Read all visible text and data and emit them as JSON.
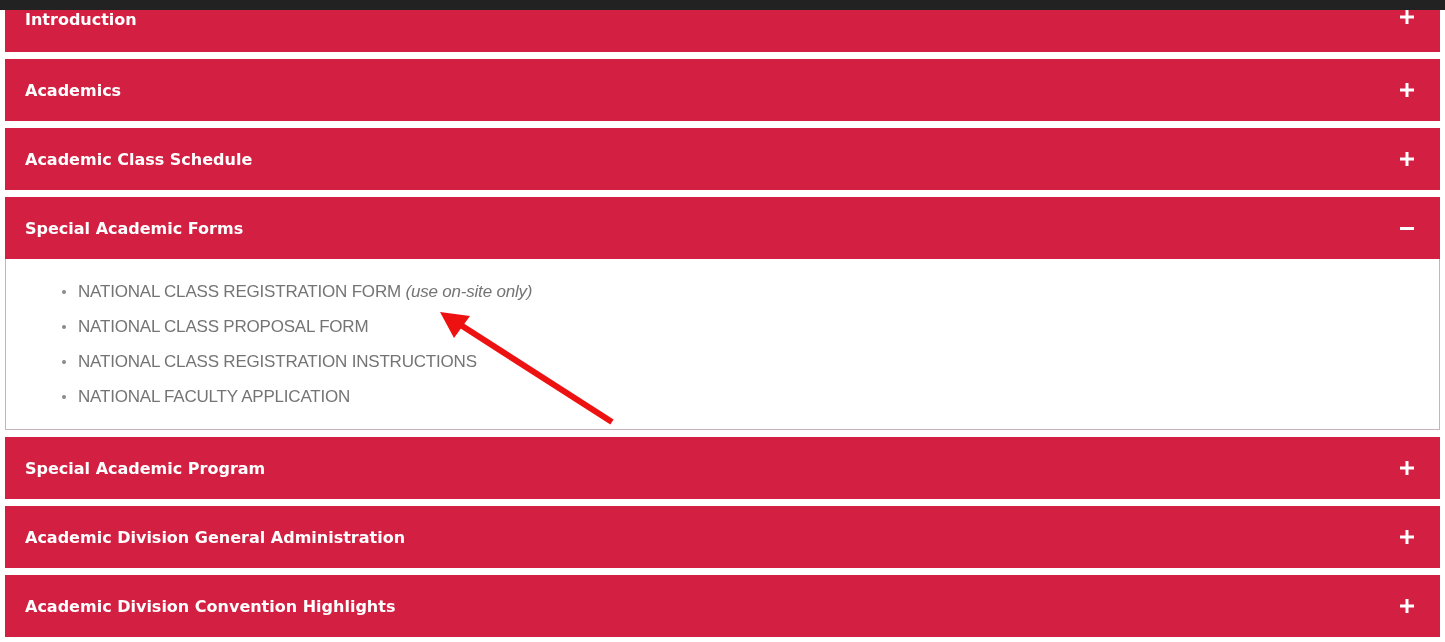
{
  "sections": [
    {
      "title": "Introduction",
      "expanded": false
    },
    {
      "title": "Academics",
      "expanded": false
    },
    {
      "title": "Academic Class Schedule",
      "expanded": false
    },
    {
      "title": "Special Academic Forms",
      "expanded": true,
      "items": [
        "NATIONAL CLASS REGISTRATION FORM *(use on-site only)*",
        "NATIONAL CLASS PROPOSAL FORM",
        "NATIONAL CLASS REGISTRATION INSTRUCTIONS",
        "NATIONAL FACULTY APPLICATION"
      ]
    },
    {
      "title": "Special Academic Program",
      "expanded": false
    },
    {
      "title": "Academic Division General Administration",
      "expanded": false
    },
    {
      "title": "Academic Division Convention Highlights",
      "expanded": false
    }
  ]
}
